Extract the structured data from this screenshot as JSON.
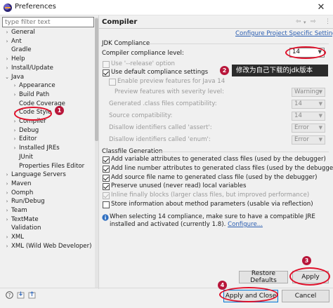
{
  "window": {
    "title": "Preferences",
    "close": "✕"
  },
  "filter": {
    "placeholder": "type filter text"
  },
  "tree": [
    {
      "label": "General",
      "expander": "›"
    },
    {
      "label": "Ant",
      "expander": "›"
    },
    {
      "label": "Gradle",
      "expander": ""
    },
    {
      "label": "Help",
      "expander": "›"
    },
    {
      "label": "Install/Update",
      "expander": "›"
    },
    {
      "label": "Java",
      "expander": "⌄"
    },
    {
      "label": "Appearance",
      "expander": "›"
    },
    {
      "label": "Build Path",
      "expander": "›"
    },
    {
      "label": "Code Coverage",
      "expander": ""
    },
    {
      "label": "Code Style",
      "expander": "›"
    },
    {
      "label": "Compiler",
      "expander": "›"
    },
    {
      "label": "Debug",
      "expander": "›"
    },
    {
      "label": "Editor",
      "expander": "›"
    },
    {
      "label": "Installed JREs",
      "expander": "›"
    },
    {
      "label": "JUnit",
      "expander": ""
    },
    {
      "label": "Properties Files Editor",
      "expander": ""
    },
    {
      "label": "Language Servers",
      "expander": "›"
    },
    {
      "label": "Maven",
      "expander": "›"
    },
    {
      "label": "Oomph",
      "expander": "›"
    },
    {
      "label": "Run/Debug",
      "expander": "›"
    },
    {
      "label": "Team",
      "expander": "›"
    },
    {
      "label": "TextMate",
      "expander": "›"
    },
    {
      "label": "Validation",
      "expander": ""
    },
    {
      "label": "XML",
      "expander": "›"
    },
    {
      "label": "XML (Wild Web Developer)",
      "expander": "›"
    }
  ],
  "page": {
    "title": "Compiler",
    "configure_link": "Configure Project Specific Settings...",
    "nav": {
      "back": "⇦",
      "back_menu": "▾",
      "forward": "⇨",
      "menu": "⋮"
    }
  },
  "jdk": {
    "group_title": "JDK Compliance",
    "compliance_label": "Compiler compliance level:",
    "compliance_value": "14",
    "release_option": "Use '--release' option",
    "use_default": "Use default compliance settings",
    "enable_preview": "Enable preview features for Java 14",
    "preview_severity": {
      "label": "Preview features with severity level:",
      "value": "Warning"
    },
    "class_files": {
      "label": "Generated .class files compatibility:",
      "value": "14"
    },
    "source_compat": {
      "label": "Source compatibility:",
      "value": "14"
    },
    "assert_id": {
      "label": "Disallow identifiers called 'assert':",
      "value": "Error"
    },
    "enum_id": {
      "label": "Disallow identifiers called 'enum':",
      "value": "Error"
    }
  },
  "classfile": {
    "group_title": "Classfile Generation",
    "options": [
      {
        "label": "Add variable attributes to generated class files (used by the debugger)",
        "checked": true,
        "enabled": true
      },
      {
        "label": "Add line number attributes to generated class files (used by the debugger)",
        "checked": true,
        "enabled": true
      },
      {
        "label": "Add source file name to generated class file (used by the debugger)",
        "checked": true,
        "enabled": true
      },
      {
        "label": "Preserve unused (never read) local variables",
        "checked": true,
        "enabled": true
      },
      {
        "label": "Inline finally blocks (larger class files, but improved performance)",
        "checked": true,
        "enabled": false
      },
      {
        "label": "Store information about method parameters (usable via reflection)",
        "checked": false,
        "enabled": true
      }
    ]
  },
  "info": {
    "text": "When selecting 14 compliance, make sure to have a compatible JRE installed and activated (currently 1.8).",
    "link": "Configure..."
  },
  "buttons": {
    "restore": "Restore Defaults",
    "apply": "Apply",
    "apply_close": "Apply and Close",
    "cancel": "Cancel"
  },
  "annotations": {
    "badge1": "1",
    "badge2": "2",
    "badge3": "3",
    "badge4": "4",
    "tooltip": "修改为自己下载的jdk版本"
  },
  "icons": {
    "help": "help-icon",
    "import": "import-icon",
    "export": "export-icon"
  },
  "colors": {
    "annotation_red": "#e0102a",
    "badge": "#b8163a",
    "link": "#2a5db0"
  }
}
